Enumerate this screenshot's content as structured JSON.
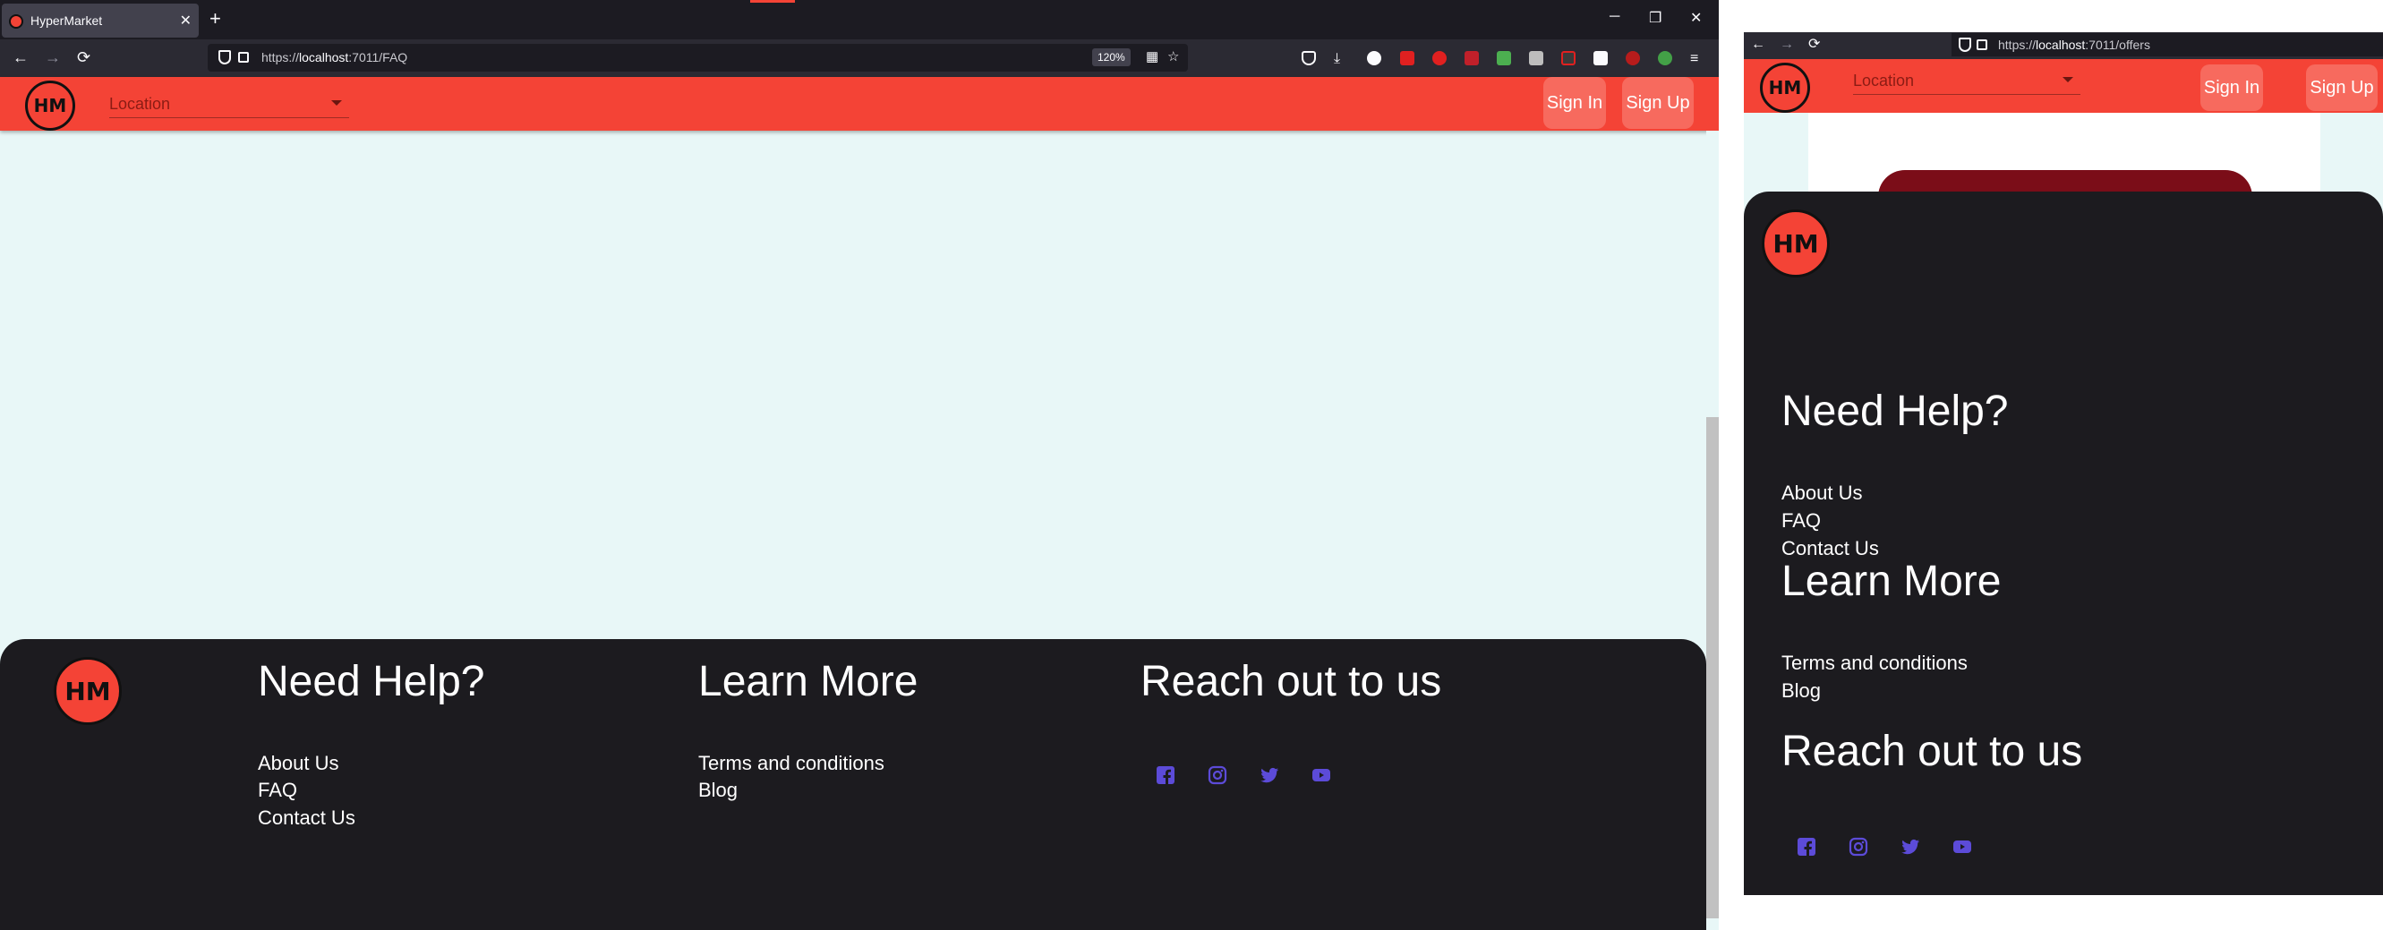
{
  "left": {
    "tab": {
      "title": "HyperMarket",
      "close": "✕"
    },
    "newtab": "+",
    "window_controls": {
      "minimize": "─",
      "restore": "❐",
      "close": "✕"
    },
    "nav": {
      "back": "←",
      "forward": "→",
      "reload": "⟳"
    },
    "url": {
      "scheme": "https://",
      "host": "localhost",
      "path": ":7011/FAQ"
    },
    "zoom": "120%",
    "appbar": {
      "logo": "HM",
      "location_placeholder": "Location",
      "sign_in": "Sign In",
      "sign_up": "Sign Up"
    },
    "footer": {
      "logo": "HM",
      "need_help": {
        "title": "Need Help?",
        "links": [
          "About Us",
          "FAQ",
          "Contact Us"
        ]
      },
      "learn_more": {
        "title": "Learn More",
        "links": [
          "Terms and conditions",
          "Blog"
        ]
      },
      "reach_out": {
        "title": "Reach out to us",
        "icons": [
          "facebook-icon",
          "instagram-icon",
          "twitter-icon",
          "youtube-icon"
        ]
      }
    }
  },
  "right": {
    "nav": {
      "back": "←",
      "forward": "→",
      "reload": "⟳"
    },
    "url": {
      "scheme": "https://",
      "host": "localhost",
      "path": ":7011/offers"
    },
    "appbar": {
      "logo": "HM",
      "location_placeholder": "Location",
      "sign_in": "Sign In",
      "sign_up": "Sign Up"
    },
    "footer": {
      "logo": "HM",
      "need_help": {
        "title": "Need Help?",
        "links": [
          "About Us",
          "FAQ",
          "Contact Us"
        ]
      },
      "learn_more": {
        "title": "Learn More",
        "links": [
          "Terms and conditions",
          "Blog"
        ]
      },
      "reach_out": {
        "title": "Reach out to us",
        "icons": [
          "facebook-icon",
          "instagram-icon",
          "twitter-icon",
          "youtube-icon"
        ]
      }
    }
  },
  "colors": {
    "accent": "#f44336",
    "footer_bg": "#1c1b1f",
    "page_bg": "#e8f7f7",
    "social": "#5c4bd8",
    "button": "#f76a5e"
  }
}
